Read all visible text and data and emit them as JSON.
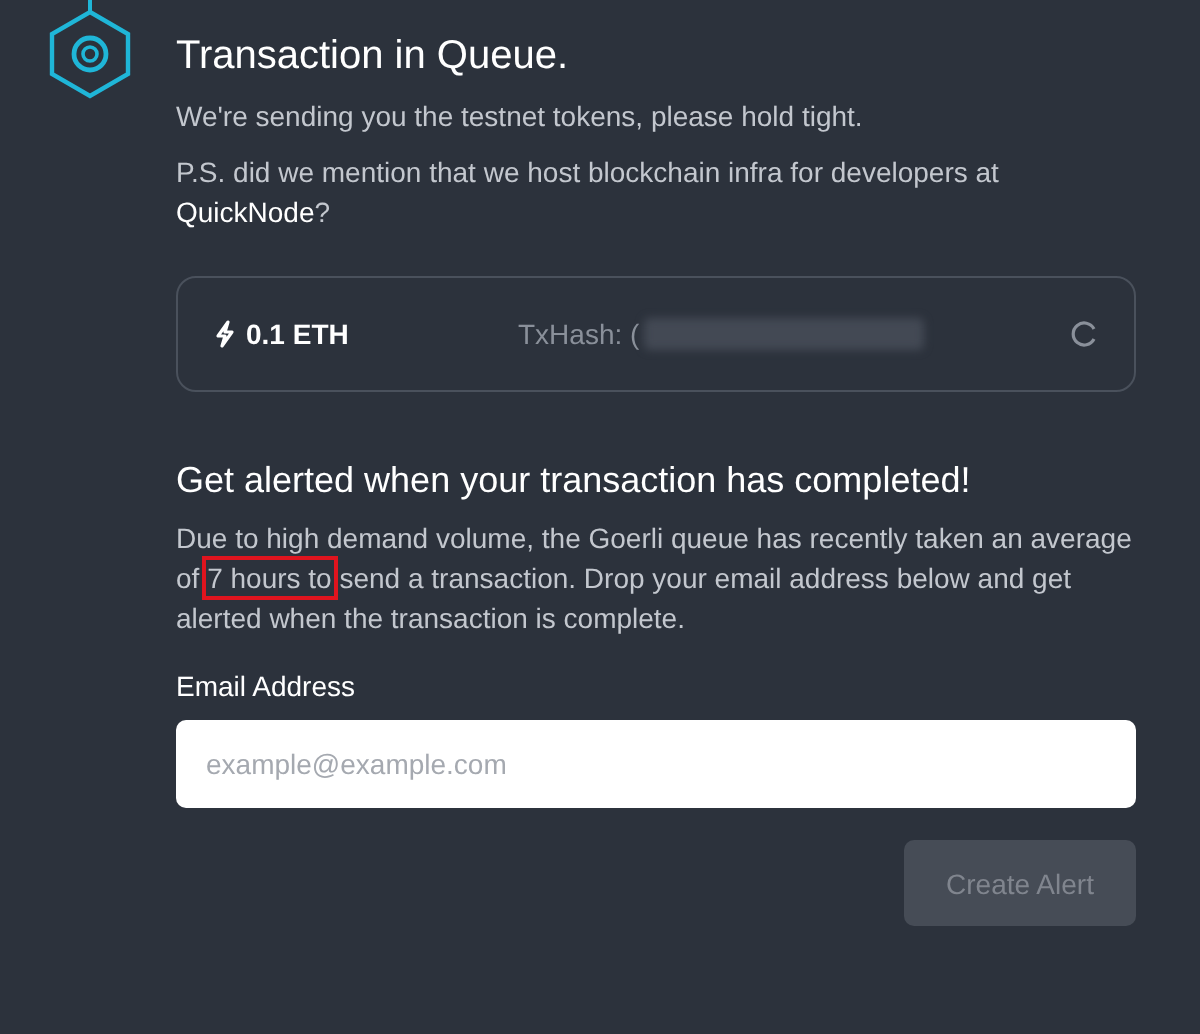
{
  "title": "Transaction in Queue.",
  "intro": "We're sending you the testnet tokens, please hold tight.",
  "promo": "P.S. did we mention that we host blockchain infra for developers at **QuickNode**?",
  "transaction": {
    "amount": "0.1 ETH",
    "hash_label": "TxHash: ("
  },
  "alert": {
    "heading": "Get alerted when your transaction has completed!",
    "text_before": "Due to high demand volume, the Goerli queue has recently taken an average of ",
    "text_highlighted": "7 hours to",
    "text_after": " send a transaction. Drop your email address below and get alerted when the transaction is complete.",
    "highlighted": true,
    "email_label": "Email Address",
    "email_placeholder": "example@example.com",
    "button": {
      "label": "Create Alert",
      "disabled": true
    }
  }
}
